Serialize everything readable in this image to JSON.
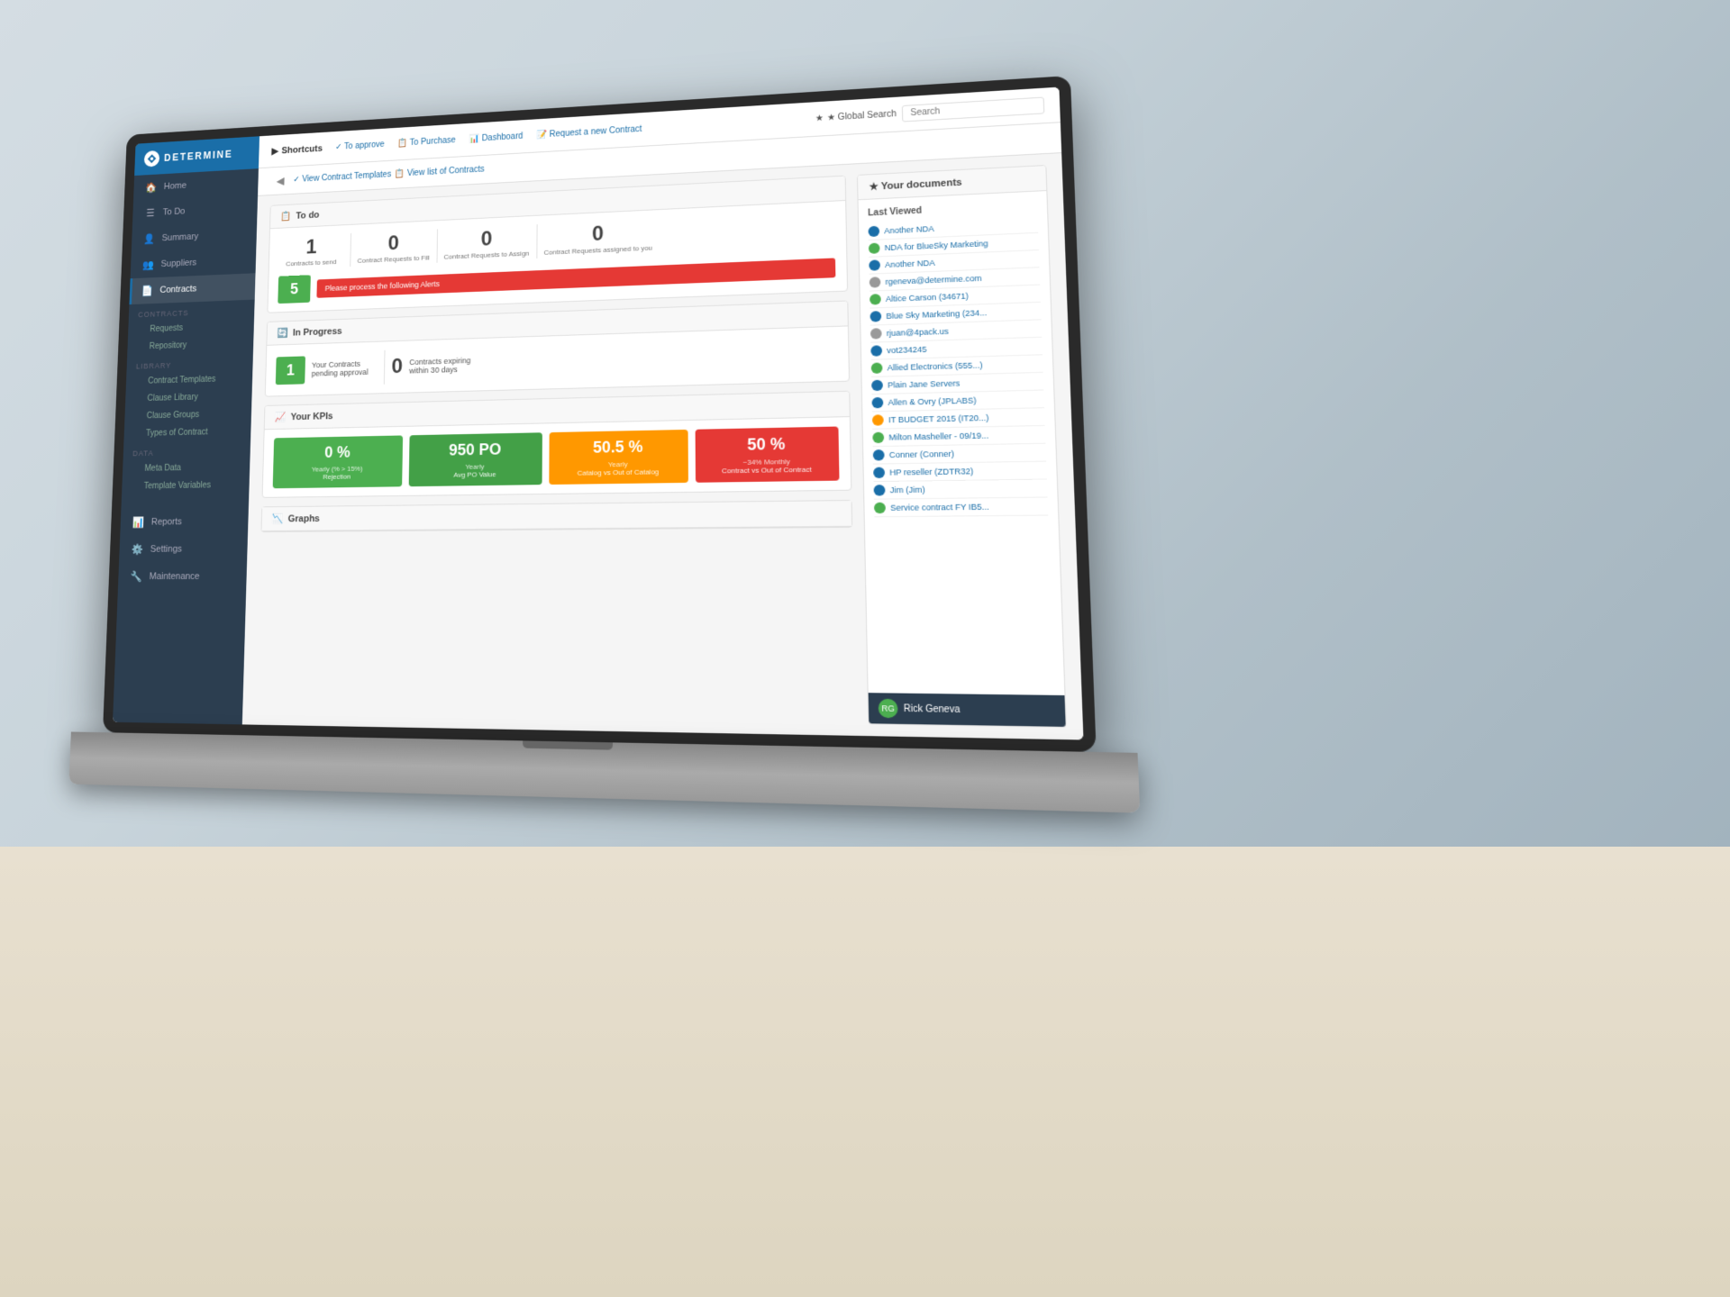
{
  "app": {
    "name": "DETERMINE",
    "logo_text": "DETERMINE"
  },
  "sidebar": {
    "items": [
      {
        "id": "home",
        "label": "Home",
        "icon": "🏠"
      },
      {
        "id": "todo",
        "label": "To Do",
        "icon": "☰"
      },
      {
        "id": "summary",
        "label": "Summary",
        "icon": "👤"
      },
      {
        "id": "suppliers",
        "label": "Suppliers",
        "icon": "👥"
      },
      {
        "id": "contracts",
        "label": "Contracts",
        "icon": "📄",
        "active": true
      }
    ],
    "contracts_sub": {
      "section_contracts": "CONTRACTS",
      "items_contracts": [
        "Requests",
        "Repository"
      ],
      "section_library": "LIBRARY",
      "items_library": [
        "Contract Templates",
        "Clause Library",
        "Clause Groups",
        "Types of Contract"
      ],
      "section_data": "DATA",
      "items_data": [
        "Meta Data",
        "Template Variables"
      ]
    },
    "bottom_items": [
      {
        "id": "reports",
        "label": "Reports",
        "icon": "📊"
      },
      {
        "id": "settings",
        "label": "Settings",
        "icon": "⚙️"
      },
      {
        "id": "maintenance",
        "label": "Maintenance",
        "icon": "🔧"
      }
    ]
  },
  "shortcuts": {
    "title": "Shortcuts",
    "items": [
      {
        "label": "✓ To approve"
      },
      {
        "label": "📋 To Purchase"
      },
      {
        "label": "📊 Dashboard"
      },
      {
        "label": "📝 Request a new Contract"
      },
      {
        "label": "✓ To approve"
      },
      {
        "label": "🗂 View Contract Templates"
      },
      {
        "label": "📋 View list of Contracts"
      }
    ]
  },
  "search": {
    "label": "★ Global Search",
    "placeholder": "Search"
  },
  "nav_tabs": [
    {
      "label": "✓ To approve",
      "active": false
    },
    {
      "label": "📋 To Purchase",
      "active": false
    },
    {
      "label": "📊 Dashboard",
      "active": false
    },
    {
      "label": "📝 Request a new Contract",
      "active": false
    }
  ],
  "todo_section": {
    "title": "To do",
    "counters": [
      {
        "value": "0",
        "label": "Contract Requests to Fill"
      },
      {
        "value": "0",
        "label": "Contract Requests to Assign"
      },
      {
        "value": "0",
        "label": "Contract Requests assigned to you"
      }
    ],
    "contracts_to_send": {
      "number": "1",
      "label": "Contracts to send"
    },
    "alert": {
      "number": "5",
      "message": "Please process the following Alerts"
    }
  },
  "in_progress_section": {
    "title": "In Progress",
    "items": [
      {
        "number": "1",
        "label": "Your Contracts pending approval"
      },
      {
        "number": "0",
        "label": "Contracts expiring within 30 days"
      }
    ]
  },
  "kpi_section": {
    "title": "Your KPIs",
    "cards": [
      {
        "value": "0 %",
        "sublabel": "Yearly (% > 15%)",
        "desc": "Rejection",
        "color": "green"
      },
      {
        "value": "950 PO",
        "sublabel": "Yearly",
        "desc": "Avg PO Value",
        "color": "green2"
      },
      {
        "value": "50.5 %",
        "sublabel": "Yearly",
        "desc": "Catalog vs Out of Catalog",
        "color": "orange"
      },
      {
        "value": "50 %",
        "sublabel": "~34% Monthly",
        "desc": "Contract vs Out of Contract",
        "color": "red"
      }
    ]
  },
  "graphs_section": {
    "title": "Graphs"
  },
  "documents_panel": {
    "title": "★ Your documents",
    "last_viewed_label": "Last Viewed",
    "items": [
      {
        "label": "Another NDA",
        "color": "blue"
      },
      {
        "label": "NDA for BlueSky Marketing",
        "color": "green"
      },
      {
        "label": "Another NDA",
        "color": "blue"
      },
      {
        "label": "rgeneva@determine.com",
        "color": "gray"
      },
      {
        "label": "Altice Carson (34671)",
        "color": "green"
      },
      {
        "label": "Blue Sky Marketing (234...",
        "color": "blue"
      },
      {
        "label": "rjuan@4pack.us",
        "color": "gray"
      },
      {
        "label": "vot234245",
        "color": "blue"
      },
      {
        "label": "Allied Electronics (555...)",
        "color": "green"
      },
      {
        "label": "Plain Jane Servers",
        "color": "blue"
      },
      {
        "label": "Allen & Ovry (JPLABS)",
        "color": "blue"
      },
      {
        "label": "IT BUDGET 2015 (IT20...)",
        "color": "orange"
      },
      {
        "label": "Milton Masheller - 09/19...",
        "color": "green"
      },
      {
        "label": "Conner (Conner)",
        "color": "blue"
      },
      {
        "label": "HP reseller (ZDTR32)",
        "color": "blue"
      },
      {
        "label": "Jim (Jim)",
        "color": "blue"
      },
      {
        "label": "Service contract FY IB5...",
        "color": "green"
      }
    ]
  },
  "user": {
    "name": "Rick Geneva",
    "avatar_initials": "RG"
  }
}
